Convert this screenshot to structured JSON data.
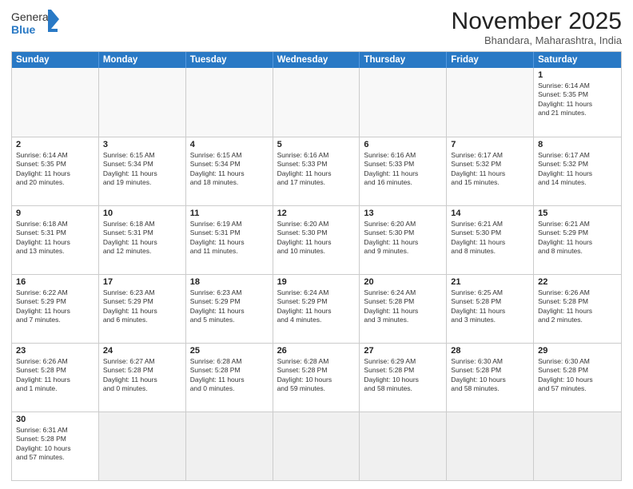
{
  "logo": {
    "text_general": "General",
    "text_blue": "Blue"
  },
  "title": "November 2025",
  "location": "Bhandara, Maharashtra, India",
  "header_days": [
    "Sunday",
    "Monday",
    "Tuesday",
    "Wednesday",
    "Thursday",
    "Friday",
    "Saturday"
  ],
  "weeks": [
    [
      {
        "day": "",
        "info": ""
      },
      {
        "day": "",
        "info": ""
      },
      {
        "day": "",
        "info": ""
      },
      {
        "day": "",
        "info": ""
      },
      {
        "day": "",
        "info": ""
      },
      {
        "day": "",
        "info": ""
      },
      {
        "day": "1",
        "info": "Sunrise: 6:14 AM\nSunset: 5:35 PM\nDaylight: 11 hours\nand 21 minutes."
      }
    ],
    [
      {
        "day": "2",
        "info": "Sunrise: 6:14 AM\nSunset: 5:35 PM\nDaylight: 11 hours\nand 20 minutes."
      },
      {
        "day": "3",
        "info": "Sunrise: 6:15 AM\nSunset: 5:34 PM\nDaylight: 11 hours\nand 19 minutes."
      },
      {
        "day": "4",
        "info": "Sunrise: 6:15 AM\nSunset: 5:34 PM\nDaylight: 11 hours\nand 18 minutes."
      },
      {
        "day": "5",
        "info": "Sunrise: 6:16 AM\nSunset: 5:33 PM\nDaylight: 11 hours\nand 17 minutes."
      },
      {
        "day": "6",
        "info": "Sunrise: 6:16 AM\nSunset: 5:33 PM\nDaylight: 11 hours\nand 16 minutes."
      },
      {
        "day": "7",
        "info": "Sunrise: 6:17 AM\nSunset: 5:32 PM\nDaylight: 11 hours\nand 15 minutes."
      },
      {
        "day": "8",
        "info": "Sunrise: 6:17 AM\nSunset: 5:32 PM\nDaylight: 11 hours\nand 14 minutes."
      }
    ],
    [
      {
        "day": "9",
        "info": "Sunrise: 6:18 AM\nSunset: 5:31 PM\nDaylight: 11 hours\nand 13 minutes."
      },
      {
        "day": "10",
        "info": "Sunrise: 6:18 AM\nSunset: 5:31 PM\nDaylight: 11 hours\nand 12 minutes."
      },
      {
        "day": "11",
        "info": "Sunrise: 6:19 AM\nSunset: 5:31 PM\nDaylight: 11 hours\nand 11 minutes."
      },
      {
        "day": "12",
        "info": "Sunrise: 6:20 AM\nSunset: 5:30 PM\nDaylight: 11 hours\nand 10 minutes."
      },
      {
        "day": "13",
        "info": "Sunrise: 6:20 AM\nSunset: 5:30 PM\nDaylight: 11 hours\nand 9 minutes."
      },
      {
        "day": "14",
        "info": "Sunrise: 6:21 AM\nSunset: 5:30 PM\nDaylight: 11 hours\nand 8 minutes."
      },
      {
        "day": "15",
        "info": "Sunrise: 6:21 AM\nSunset: 5:29 PM\nDaylight: 11 hours\nand 8 minutes."
      }
    ],
    [
      {
        "day": "16",
        "info": "Sunrise: 6:22 AM\nSunset: 5:29 PM\nDaylight: 11 hours\nand 7 minutes."
      },
      {
        "day": "17",
        "info": "Sunrise: 6:23 AM\nSunset: 5:29 PM\nDaylight: 11 hours\nand 6 minutes."
      },
      {
        "day": "18",
        "info": "Sunrise: 6:23 AM\nSunset: 5:29 PM\nDaylight: 11 hours\nand 5 minutes."
      },
      {
        "day": "19",
        "info": "Sunrise: 6:24 AM\nSunset: 5:29 PM\nDaylight: 11 hours\nand 4 minutes."
      },
      {
        "day": "20",
        "info": "Sunrise: 6:24 AM\nSunset: 5:28 PM\nDaylight: 11 hours\nand 3 minutes."
      },
      {
        "day": "21",
        "info": "Sunrise: 6:25 AM\nSunset: 5:28 PM\nDaylight: 11 hours\nand 3 minutes."
      },
      {
        "day": "22",
        "info": "Sunrise: 6:26 AM\nSunset: 5:28 PM\nDaylight: 11 hours\nand 2 minutes."
      }
    ],
    [
      {
        "day": "23",
        "info": "Sunrise: 6:26 AM\nSunset: 5:28 PM\nDaylight: 11 hours\nand 1 minute."
      },
      {
        "day": "24",
        "info": "Sunrise: 6:27 AM\nSunset: 5:28 PM\nDaylight: 11 hours\nand 0 minutes."
      },
      {
        "day": "25",
        "info": "Sunrise: 6:28 AM\nSunset: 5:28 PM\nDaylight: 11 hours\nand 0 minutes."
      },
      {
        "day": "26",
        "info": "Sunrise: 6:28 AM\nSunset: 5:28 PM\nDaylight: 10 hours\nand 59 minutes."
      },
      {
        "day": "27",
        "info": "Sunrise: 6:29 AM\nSunset: 5:28 PM\nDaylight: 10 hours\nand 58 minutes."
      },
      {
        "day": "28",
        "info": "Sunrise: 6:30 AM\nSunset: 5:28 PM\nDaylight: 10 hours\nand 58 minutes."
      },
      {
        "day": "29",
        "info": "Sunrise: 6:30 AM\nSunset: 5:28 PM\nDaylight: 10 hours\nand 57 minutes."
      }
    ],
    [
      {
        "day": "30",
        "info": "Sunrise: 6:31 AM\nSunset: 5:28 PM\nDaylight: 10 hours\nand 57 minutes."
      },
      {
        "day": "",
        "info": ""
      },
      {
        "day": "",
        "info": ""
      },
      {
        "day": "",
        "info": ""
      },
      {
        "day": "",
        "info": ""
      },
      {
        "day": "",
        "info": ""
      },
      {
        "day": "",
        "info": ""
      }
    ]
  ]
}
